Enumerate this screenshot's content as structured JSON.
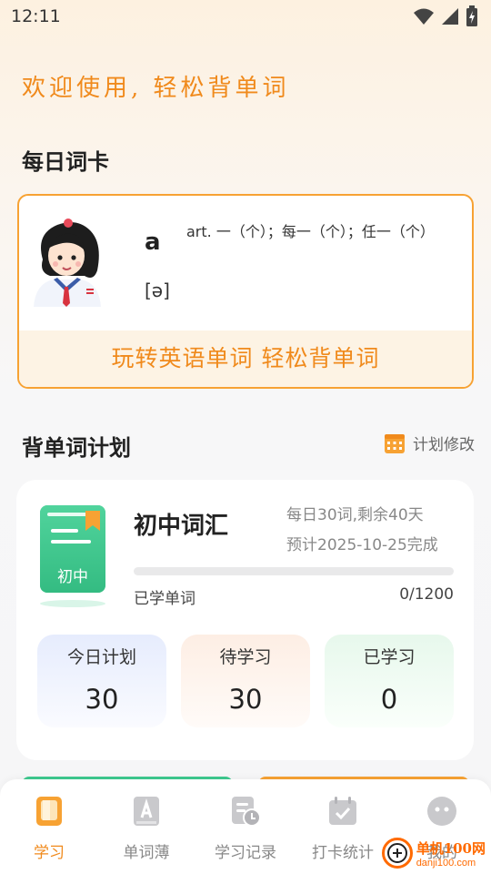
{
  "status_bar": {
    "time": "12:11"
  },
  "welcome_text": "欢迎使用, 轻松背单词",
  "daily_card": {
    "section_title": "每日词卡",
    "word": "a",
    "meaning": "art. 一（个）；每一（个）；任一（个）",
    "phonetic": "[ə]",
    "slogan": "玩转英语单词  轻松背单词"
  },
  "plan": {
    "section_title": "背单词计划",
    "edit_label": "计划修改",
    "book_label": "初中",
    "name": "初中词汇",
    "daily_info": "每日30词,剩余40天",
    "eta": "预计2025-10-25完成",
    "learned_label": "已学单词",
    "learned_count": "0/1200",
    "progress": 0,
    "stats": [
      {
        "label": "今日计划",
        "value": "30"
      },
      {
        "label": "待学习",
        "value": "30"
      },
      {
        "label": "已学习",
        "value": "0"
      }
    ]
  },
  "tabs": [
    {
      "label": "学习",
      "icon": "book-icon",
      "active": true
    },
    {
      "label": "单词薄",
      "icon": "letter-a-icon",
      "active": false
    },
    {
      "label": "学习记录",
      "icon": "record-icon",
      "active": false
    },
    {
      "label": "打卡统计",
      "icon": "calendar-check-icon",
      "active": false
    },
    {
      "label": "我的",
      "icon": "face-icon",
      "active": false
    }
  ],
  "watermark": {
    "main": "单机100网",
    "sub": "danji100.com"
  },
  "colors": {
    "accent": "#f08a1c",
    "border": "#f7a233",
    "green": "#3fc98f"
  }
}
